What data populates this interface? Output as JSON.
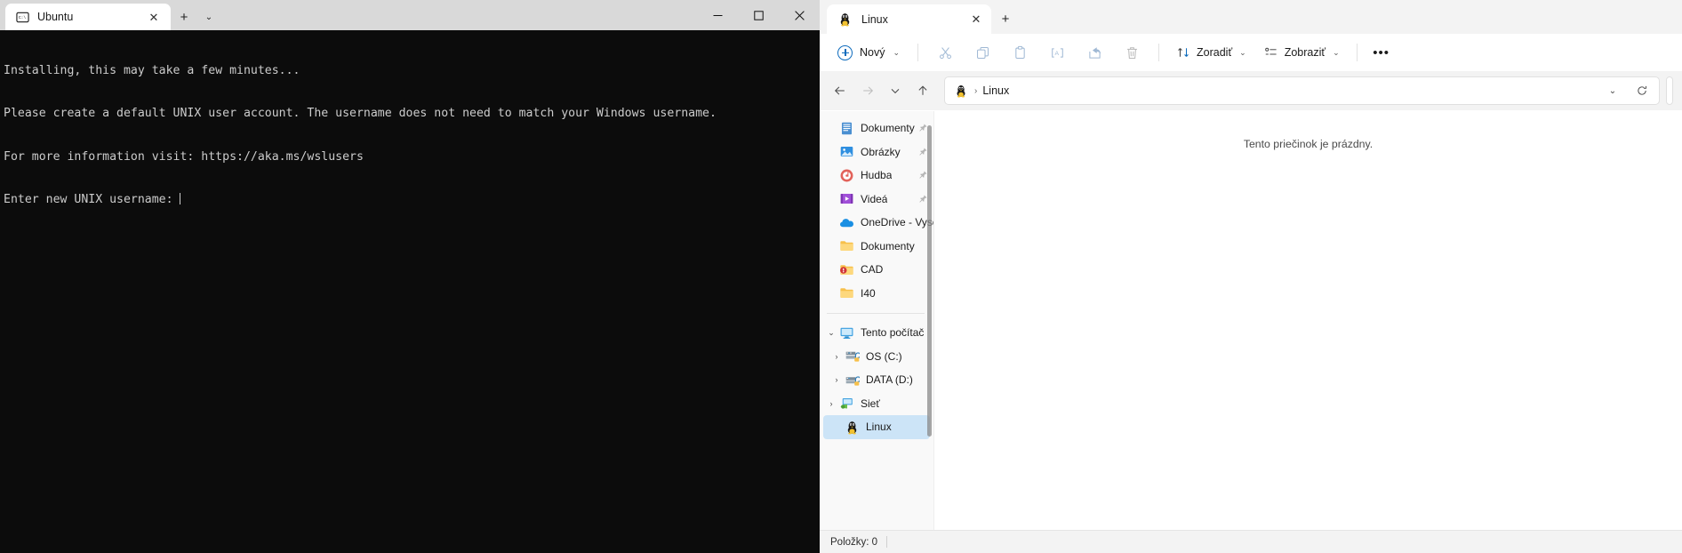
{
  "terminal": {
    "tab": {
      "title": "Ubuntu",
      "icon": "console-icon",
      "close_label": "✕"
    },
    "new_tab_label": "+",
    "tab_menu_label": "⌄",
    "caption": {
      "minimize": "minimize-icon",
      "maximize": "maximize-icon",
      "close": "close-icon"
    },
    "lines": [
      "Installing, this may take a few minutes...",
      "Please create a default UNIX user account. The username does not need to match your Windows username.",
      "For more information visit: https://aka.ms/wslusers",
      "Enter new UNIX username:"
    ],
    "background": "#0c0c0c",
    "foreground": "#cccccc"
  },
  "explorer": {
    "tab": {
      "title": "Linux",
      "icon": "tux-icon",
      "close_label": "✕"
    },
    "new_tab_label": "+",
    "toolbar": {
      "new_label": "Nový",
      "cut_label": "cut-icon",
      "copy_label": "copy-icon",
      "paste_label": "paste-icon",
      "rename_label": "rename-icon",
      "share_label": "share-icon",
      "delete_label": "delete-icon",
      "sort_label": "Zoradiť",
      "view_label": "Zobraziť",
      "more_label": "•••"
    },
    "navbar": {
      "back": "back-icon",
      "forward": "forward-icon",
      "recent": "recent-icon",
      "up": "up-icon",
      "breadcrumb_icon": "tux-icon",
      "breadcrumb": "Linux",
      "breadcrumb_sep": "›",
      "dropdown": "⌄",
      "refresh": "refresh-icon"
    },
    "sidebar": {
      "items": [
        {
          "label": "Dokumenty",
          "icon": "documents-icon",
          "pinned": true,
          "indent": 1,
          "expander": "",
          "selected": false
        },
        {
          "label": "Obrázky",
          "icon": "pictures-icon",
          "pinned": true,
          "indent": 1,
          "expander": "",
          "selected": false
        },
        {
          "label": "Hudba",
          "icon": "music-icon",
          "pinned": true,
          "indent": 1,
          "expander": "",
          "selected": false
        },
        {
          "label": "Videá",
          "icon": "videos-icon",
          "pinned": true,
          "indent": 1,
          "expander": "",
          "selected": false
        },
        {
          "label": "OneDrive - Vyso",
          "icon": "onedrive-icon",
          "pinned": false,
          "indent": 1,
          "expander": "",
          "selected": false
        },
        {
          "label": "Dokumenty",
          "icon": "folder-icon",
          "pinned": false,
          "indent": 1,
          "expander": "",
          "selected": false
        },
        {
          "label": "CAD",
          "icon": "folder-error-icon",
          "pinned": false,
          "indent": 1,
          "expander": "",
          "selected": false
        },
        {
          "label": "I40",
          "icon": "folder-icon",
          "pinned": false,
          "indent": 1,
          "expander": "",
          "selected": false
        }
      ],
      "items2": [
        {
          "label": "Tento počítač",
          "icon": "thispc-icon",
          "indent": 0,
          "expander": "⌄",
          "selected": false
        },
        {
          "label": "OS (C:)",
          "icon": "drive-icon",
          "indent": 1,
          "expander": "›",
          "selected": false
        },
        {
          "label": "DATA (D:)",
          "icon": "drive2-icon",
          "indent": 1,
          "expander": "›",
          "selected": false
        },
        {
          "label": "Sieť",
          "icon": "network-icon",
          "indent": 0,
          "expander": "›",
          "selected": false
        },
        {
          "label": "Linux",
          "icon": "tux-icon",
          "indent": 1,
          "expander": "",
          "selected": true
        }
      ]
    },
    "filepane": {
      "empty_message": "Tento priečinok je prázdny."
    },
    "statusbar": {
      "items_count": "Položky: 0"
    },
    "accent": "#0f6cbd",
    "selection_color": "#cce4f7"
  }
}
